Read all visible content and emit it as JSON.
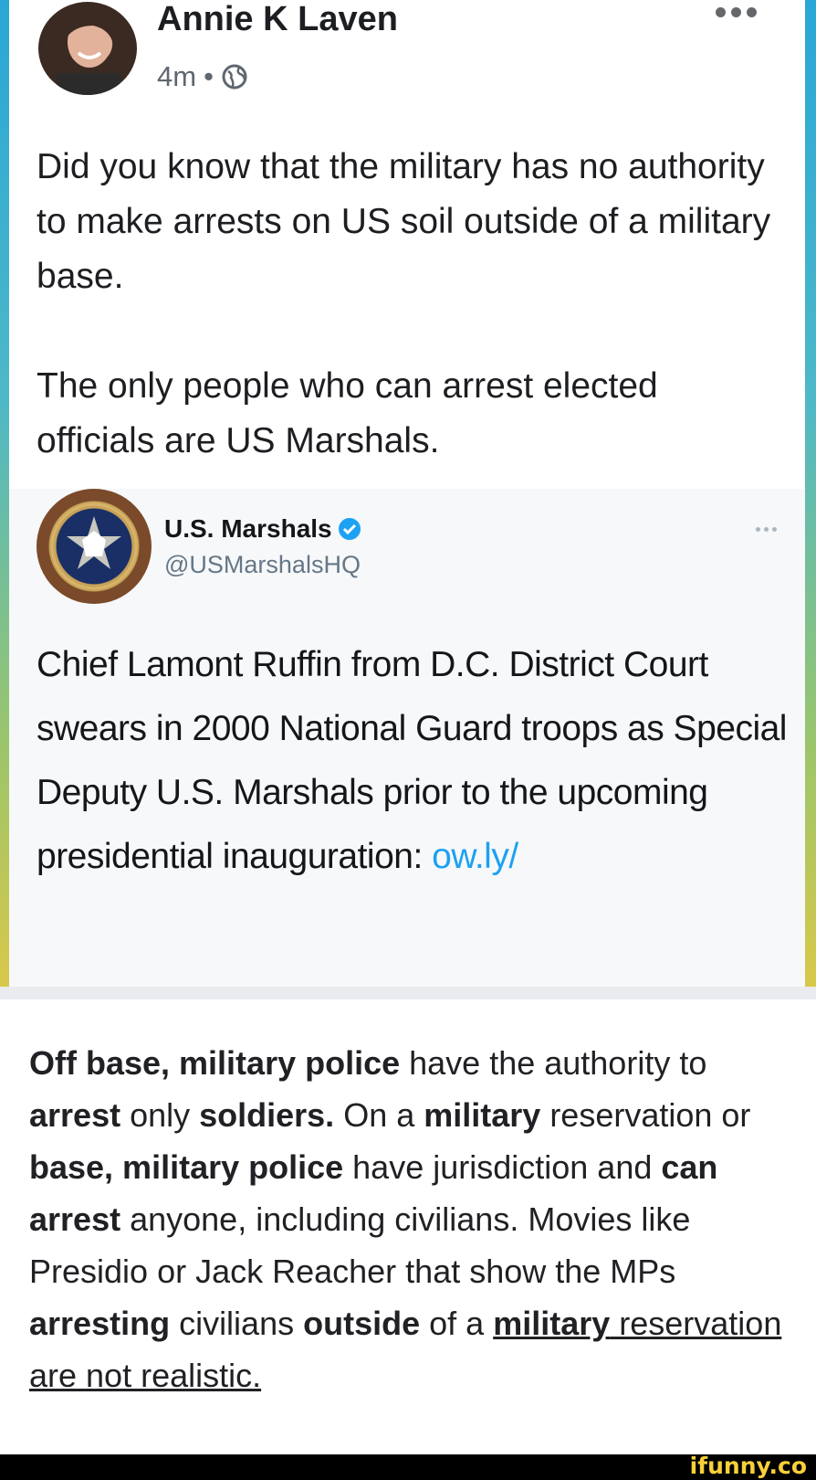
{
  "post": {
    "author": "Annie K Laven",
    "timestamp": "4m",
    "separator": "•",
    "audience_icon": "globe-icon",
    "paragraph1": "Did you know that the military has no authority to make arrests on US soil outside of a military base.",
    "paragraph2": "The only people who can arrest elected officials are US Marshals."
  },
  "tweet": {
    "name": "U.S. Marshals",
    "handle": "@USMarshalsHQ",
    "verified_icon": "verified-badge-icon",
    "text": "Chief Lamont Ruffin from D.C. District Court swears in 2000 National Guard troops as Special Deputy U.S. Marshals prior to the upcoming presidential inauguration: ",
    "link": "ow.ly/"
  },
  "explanation": {
    "s1": "Off base, military police",
    "s2": " have the authority to ",
    "s3": "arrest",
    "s4": " only ",
    "s5": "soldiers.",
    "s6": " On a ",
    "s7": "military",
    "s8": " reservation or ",
    "s9": "base, military police",
    "s10": " have jurisdiction and ",
    "s11": "can arrest",
    "s12": " anyone, including civilians. Movies like Presidio or Jack Reacher that show the MPs ",
    "s13": "arresting",
    "s14": " civilians ",
    "s15": "outside",
    "s16": " of a ",
    "s17": "military",
    "s18": " reservation are not realistic."
  },
  "footer": {
    "watermark": "ifunny.co"
  },
  "colors": {
    "accent_link": "#1da1f2",
    "watermark": "#f9d03a",
    "meta_gray": "#606770"
  }
}
